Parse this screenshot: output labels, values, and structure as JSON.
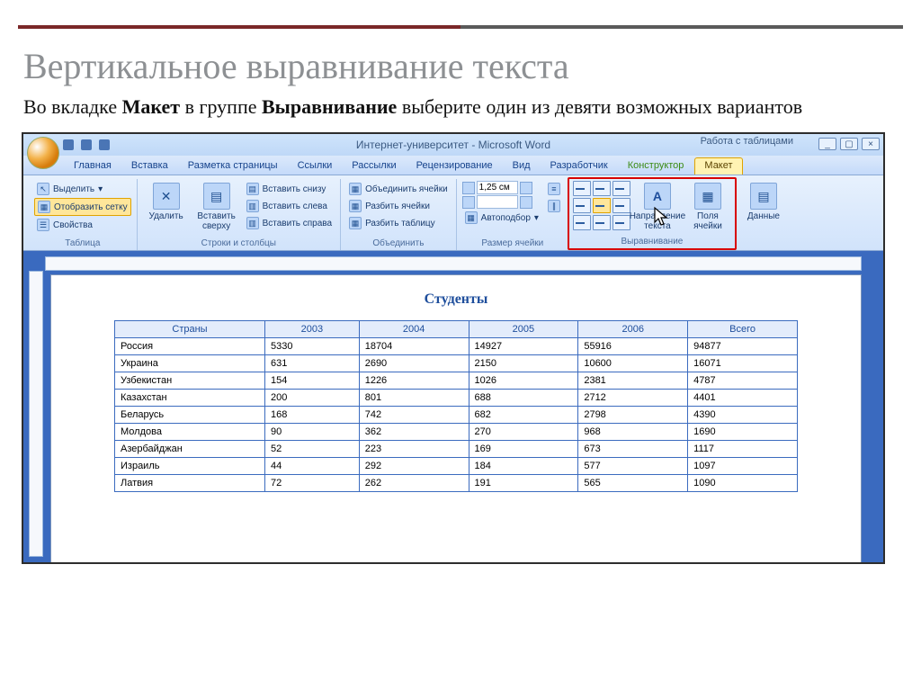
{
  "slide": {
    "title": "Вертикальное выравнивание текста",
    "subtitle_pre": "Во вкладке ",
    "subtitle_b1": "Макет",
    "subtitle_mid": " в группе ",
    "subtitle_b2": "Выравнивание",
    "subtitle_post": " выберите один из девяти возможных вариантов"
  },
  "word": {
    "window_title": "Интернет-университет - Microsoft Word",
    "table_tools": "Работа с таблицами",
    "tabs": [
      "Главная",
      "Вставка",
      "Разметка страницы",
      "Ссылки",
      "Рассылки",
      "Рецензирование",
      "Вид",
      "Разработчик",
      "Конструктор",
      "Макет"
    ],
    "active_tab_index": 9,
    "ribbon": {
      "table": {
        "label": "Таблица",
        "select": "Выделить",
        "show_grid": "Отобразить сетку",
        "properties": "Свойства"
      },
      "rows_cols": {
        "label": "Строки и столбцы",
        "delete": "Удалить",
        "insert_above": "Вставить сверху",
        "insert_below": "Вставить снизу",
        "insert_left": "Вставить слева",
        "insert_right": "Вставить справа"
      },
      "merge": {
        "label": "Объединить",
        "merge_cells": "Объединить ячейки",
        "split_cells": "Разбить ячейки",
        "split_table": "Разбить таблицу"
      },
      "cell_size": {
        "label": "Размер ячейки",
        "height": "1,25 см",
        "autofit": "Автоподбор"
      },
      "alignment": {
        "label": "Выравнивание",
        "text_direction": "Направление текста",
        "cell_margins": "Поля ячейки"
      },
      "data": {
        "label": "Данные",
        "btn": "Данные"
      }
    },
    "doc": {
      "title": "Студенты",
      "headers": [
        "Страны",
        "2003",
        "2004",
        "2005",
        "2006",
        "Всего"
      ],
      "rows": [
        [
          "Россия",
          "5330",
          "18704",
          "14927",
          "55916",
          "94877"
        ],
        [
          "Украина",
          "631",
          "2690",
          "2150",
          "10600",
          "16071"
        ],
        [
          "Узбекистан",
          "154",
          "1226",
          "1026",
          "2381",
          "4787"
        ],
        [
          "Казахстан",
          "200",
          "801",
          "688",
          "2712",
          "4401"
        ],
        [
          "Беларусь",
          "168",
          "742",
          "682",
          "2798",
          "4390"
        ],
        [
          "Молдова",
          "90",
          "362",
          "270",
          "968",
          "1690"
        ],
        [
          "Азербайджан",
          "52",
          "223",
          "169",
          "673",
          "1117"
        ],
        [
          "Израиль",
          "44",
          "292",
          "184",
          "577",
          "1097"
        ],
        [
          "Латвия",
          "72",
          "262",
          "191",
          "565",
          "1090"
        ]
      ]
    }
  }
}
